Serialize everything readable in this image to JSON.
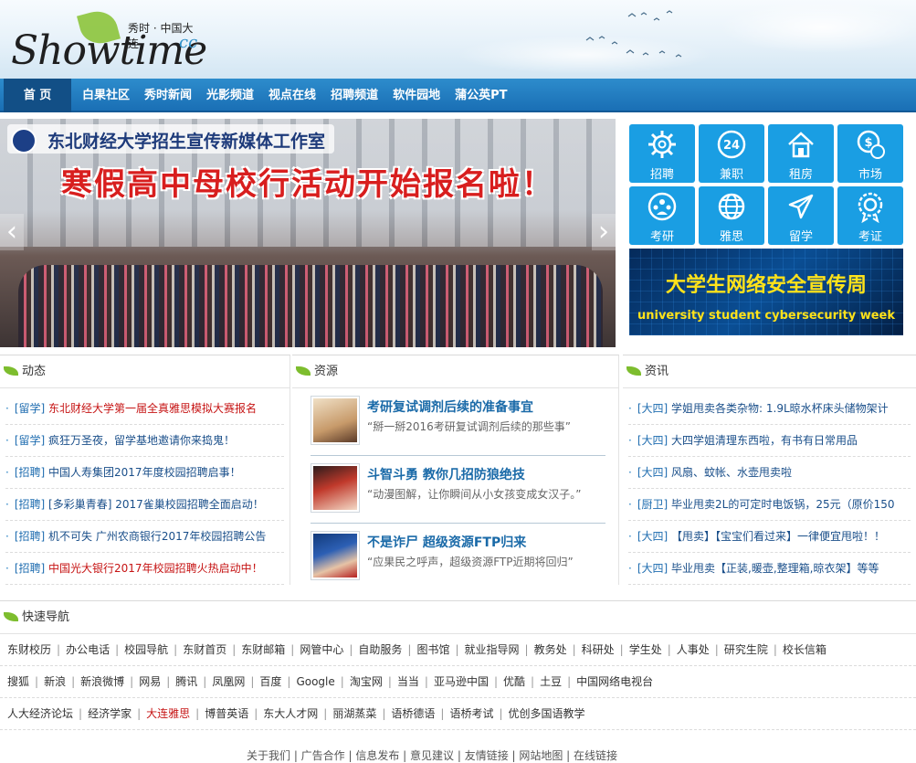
{
  "logo": {
    "tagline": "秀时 · 中国大连",
    "name": "Showtime",
    "suffix": "cc"
  },
  "nav": [
    "首 页",
    "白果社区",
    "秀时新闻",
    "光影频道",
    "视点在线",
    "招聘频道",
    "软件园地",
    "蒲公英PT"
  ],
  "banner": {
    "subtitle": "东北财经大学招生宣传新媒体工作室",
    "headline": "寒假高中母校行活动开始报名啦！",
    "prev": "‹",
    "next": "›"
  },
  "services": [
    {
      "label": "招聘",
      "icon": "gear-icon"
    },
    {
      "label": "兼职",
      "icon": "clock-24-icon"
    },
    {
      "label": "租房",
      "icon": "house-icon"
    },
    {
      "label": "市场",
      "icon": "money-bag-icon"
    },
    {
      "label": "考研",
      "icon": "people-icon"
    },
    {
      "label": "雅思",
      "icon": "globe-icon"
    },
    {
      "label": "留学",
      "icon": "airplane-icon"
    },
    {
      "label": "考证",
      "icon": "badge-icon"
    }
  ],
  "cyber_banner": {
    "title": "大学生网络安全宣传周",
    "subtitle": "university student cybersecurity week"
  },
  "news": {
    "title": "动态",
    "items": [
      {
        "cat": "[留学]",
        "text": "东北财经大学第一届全真雅思模拟大赛报名",
        "red": true
      },
      {
        "cat": "[留学]",
        "text": "疯狂万圣夜，留学基地邀请你来捣鬼！",
        "red": false
      },
      {
        "cat": "[招聘]",
        "text": "中国人寿集团2017年度校园招聘启事！",
        "red": false
      },
      {
        "cat": "[招聘]",
        "text": "[多彩巢青春] 2017雀巢校园招聘全面启动！",
        "red": false
      },
      {
        "cat": "[招聘]",
        "text": "机不可失 广州农商银行2017年校园招聘公告",
        "red": false
      },
      {
        "cat": "[招聘]",
        "text": "中国光大银行2017年校园招聘火热启动中！",
        "red": true
      }
    ]
  },
  "resources": {
    "title": "资源",
    "items": [
      {
        "title": "考研复试调剂后续的准备事宜",
        "desc": "“掰一掰2016考研复试调剂后续的那些事”"
      },
      {
        "title": "斗智斗勇 教你几招防狼绝技",
        "desc": "“动漫图解，让你瞬间从小女孩变成女汉子。”"
      },
      {
        "title": "不是诈尸 超级资源FTP归来",
        "desc": "“应果民之呼声，超级资源FTP近期将回归”"
      }
    ]
  },
  "info": {
    "title": "资讯",
    "items": [
      {
        "cat": "[大四]",
        "text": "学姐甩卖各类杂物: 1.9L晾水杯床头储物架计"
      },
      {
        "cat": "[大四]",
        "text": "大四学姐清理东西啦，有书有日常用品"
      },
      {
        "cat": "[大四]",
        "text": "风扇、蚊帐、水壶甩卖啦"
      },
      {
        "cat": "[厨卫]",
        "text": "毕业甩卖2L的可定时电饭锅，25元（原价150"
      },
      {
        "cat": "[大四]",
        "text": "【甩卖】【宝宝们看过来】一律便宜甩啦！！"
      },
      {
        "cat": "[大四]",
        "text": "毕业甩卖【正装,暖壶,整理箱,晾衣架】等等"
      }
    ]
  },
  "quicknav": {
    "title": "快速导航",
    "rows": [
      [
        "东财校历",
        "办公电话",
        "校园导航",
        "东财首页",
        "东财邮箱",
        "网管中心",
        "自助服务",
        "图书馆",
        "就业指导网",
        "教务处",
        "科研处",
        "学生处",
        "人事处",
        "研究生院",
        "校长信箱"
      ],
      [
        "搜狐",
        "新浪",
        "新浪微博",
        "网易",
        "腾讯",
        "凤凰网",
        "百度",
        "Google",
        "淘宝网",
        "当当",
        "亚马逊中国",
        "优酷",
        "土豆",
        "中国网络电视台"
      ],
      [
        "人大经济论坛",
        "经济学家",
        "大连雅思",
        "博普英语",
        "东大人才网",
        "丽湖蒸菜",
        "语桥德语",
        "语桥考试",
        "优创多国语教学"
      ]
    ],
    "red_link": "大连雅思"
  },
  "footer": "关于我们 | 广告合作 | 信息发布 | 意见建议 | 友情链接 | 网站地图 | 在线链接"
}
